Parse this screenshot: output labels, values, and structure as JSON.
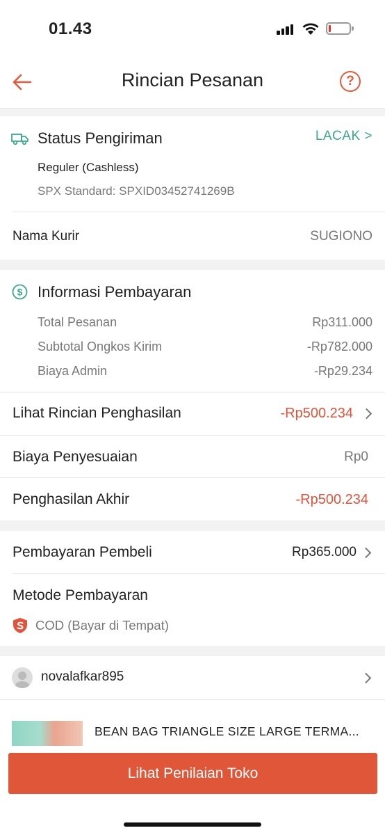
{
  "status_bar": {
    "time": "01.43"
  },
  "header": {
    "title": "Rincian Pesanan",
    "help": "?"
  },
  "shipping": {
    "title": "Status Pengiriman",
    "track_label": "LACAK >",
    "service": "Reguler (Cashless)",
    "tracking": "SPX Standard: SPXID03452741269B",
    "courier_label": "Nama Kurir",
    "courier_value": "SUGIONO"
  },
  "payment_info": {
    "title": "Informasi Pembayaran",
    "lines": [
      {
        "label": "Total Pesanan",
        "value": "Rp311.000"
      },
      {
        "label": "Subtotal Ongkos Kirim",
        "value": "-Rp782.000"
      },
      {
        "label": "Biaya Admin",
        "value": "-Rp29.234"
      }
    ],
    "income_detail_label": "Lihat Rincian Penghasilan",
    "income_detail_value": "-Rp500.234",
    "adjustment_label": "Biaya Penyesuaian",
    "adjustment_value": "Rp0",
    "final_label": "Penghasilan Akhir",
    "final_value": "-Rp500.234"
  },
  "buyer_payment": {
    "label": "Pembayaran Pembeli",
    "value": "Rp365.000",
    "method_label": "Metode Pembayaran",
    "method_value": "COD (Bayar di Tempat)"
  },
  "buyer": {
    "username": "novalafkar895"
  },
  "product": {
    "name": "BEAN BAG TRIANGLE SIZE LARGE TERMA..."
  },
  "cta": {
    "label": "Lihat Penilaian Toko"
  },
  "colors": {
    "accent": "#e05638",
    "teal": "#3aa98d"
  }
}
